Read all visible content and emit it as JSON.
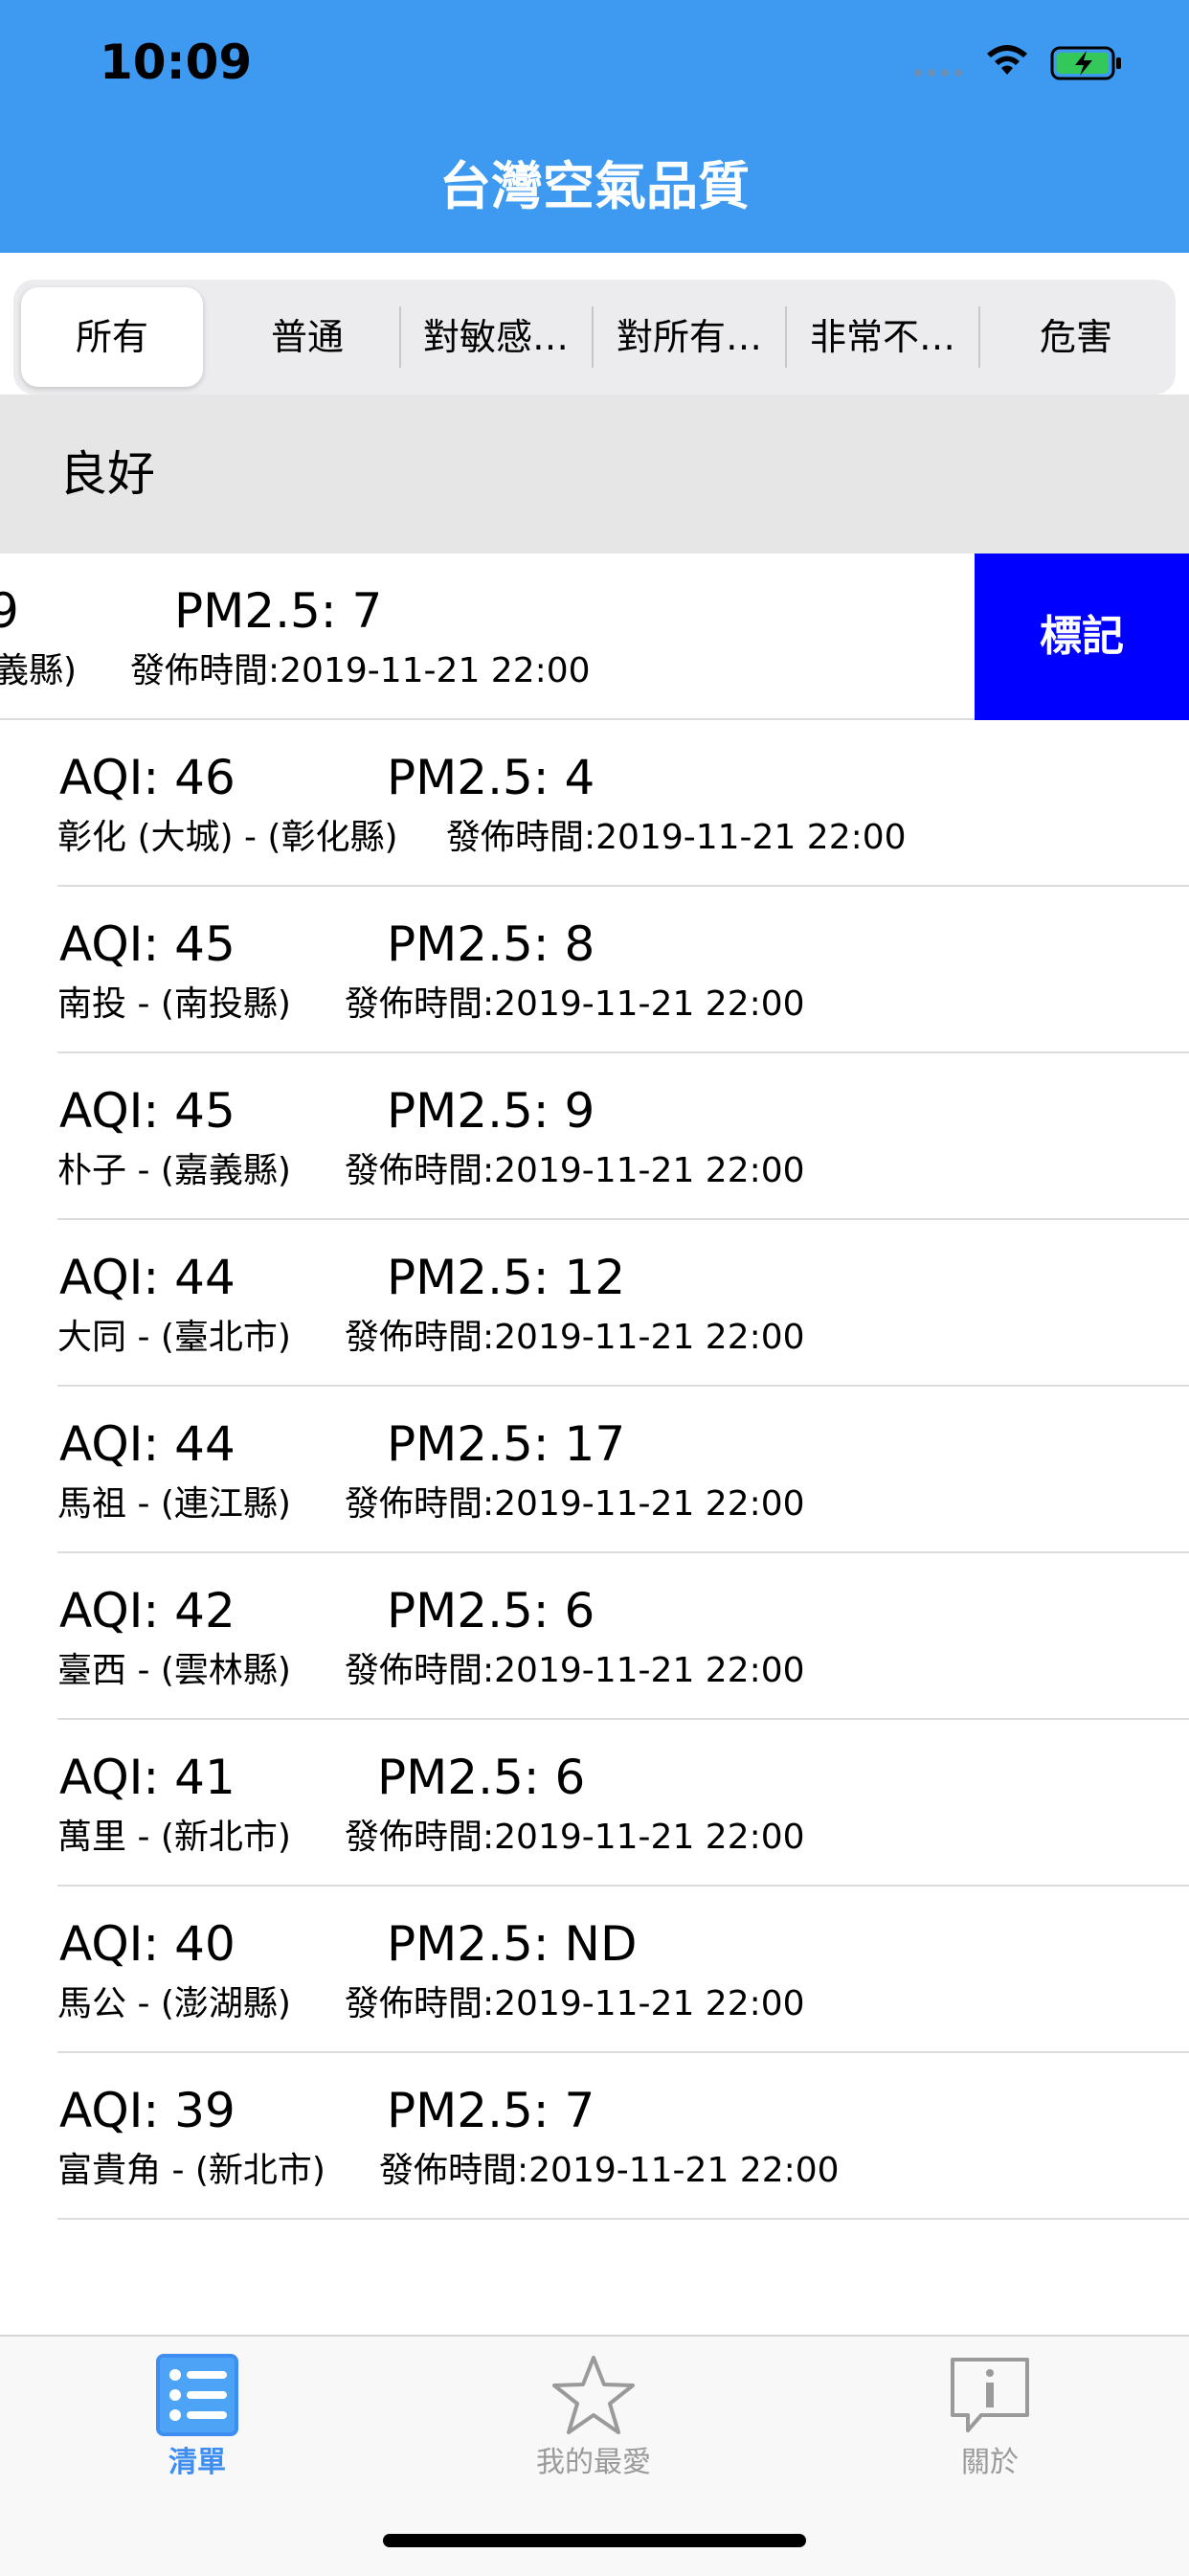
{
  "status_bar": {
    "time": "10:09"
  },
  "nav": {
    "title": "台灣空氣品質"
  },
  "segments": [
    {
      "label": "所有",
      "active": true
    },
    {
      "label": "普通",
      "active": false
    },
    {
      "label": "對敏感…",
      "active": false
    },
    {
      "label": "對所有…",
      "active": false
    },
    {
      "label": "非常不…",
      "active": false
    },
    {
      "label": "危害",
      "active": false
    }
  ],
  "section": {
    "title": "良好"
  },
  "rows": [
    {
      "aqi": "9",
      "pm": "PM2.5: 7",
      "site": "義縣)",
      "time": "發佈時間:2019-11-21 22:00",
      "action": "標記"
    },
    {
      "aqi": "AQI: 46",
      "pm": "PM2.5: 4",
      "site": "彰化 (大城) - (彰化縣)",
      "time": "發佈時間:2019-11-21 22:00"
    },
    {
      "aqi": "AQI: 45",
      "pm": "PM2.5: 8",
      "site": "南投 - (南投縣)",
      "time": "發佈時間:2019-11-21 22:00"
    },
    {
      "aqi": "AQI: 45",
      "pm": "PM2.5: 9",
      "site": "朴子 - (嘉義縣)",
      "time": "發佈時間:2019-11-21 22:00"
    },
    {
      "aqi": "AQI: 44",
      "pm": "PM2.5: 12",
      "site": "大同 - (臺北市)",
      "time": "發佈時間:2019-11-21 22:00"
    },
    {
      "aqi": "AQI: 44",
      "pm": "PM2.5: 17",
      "site": "馬祖 - (連江縣)",
      "time": "發佈時間:2019-11-21 22:00"
    },
    {
      "aqi": "AQI: 42",
      "pm": "PM2.5: 6",
      "site": "臺西 - (雲林縣)",
      "time": "發佈時間:2019-11-21 22:00"
    },
    {
      "aqi": "AQI: 41",
      "pm": "PM2.5: 6",
      "site": "萬里 - (新北市)",
      "time": "發佈時間:2019-11-21 22:00"
    },
    {
      "aqi": "AQI: 40",
      "pm": "PM2.5: ND",
      "site": "馬公 - (澎湖縣)",
      "time": "發佈時間:2019-11-21 22:00"
    },
    {
      "aqi": "AQI: 39",
      "pm": "PM2.5: 7",
      "site": "富貴角 - (新北市)",
      "time": "發佈時間:2019-11-21 22:00"
    }
  ],
  "tabbar": {
    "items": [
      {
        "label": "清單",
        "icon": "list-icon",
        "active": true
      },
      {
        "label": "我的最愛",
        "icon": "star-icon",
        "active": false
      },
      {
        "label": "關於",
        "icon": "info-bubble-icon",
        "active": false
      }
    ]
  },
  "colors": {
    "nav_background": "#3d9af0",
    "swipe_action": "#0000ff",
    "tab_active": "#3d8ef0",
    "tab_inactive": "#9a9a9a"
  }
}
